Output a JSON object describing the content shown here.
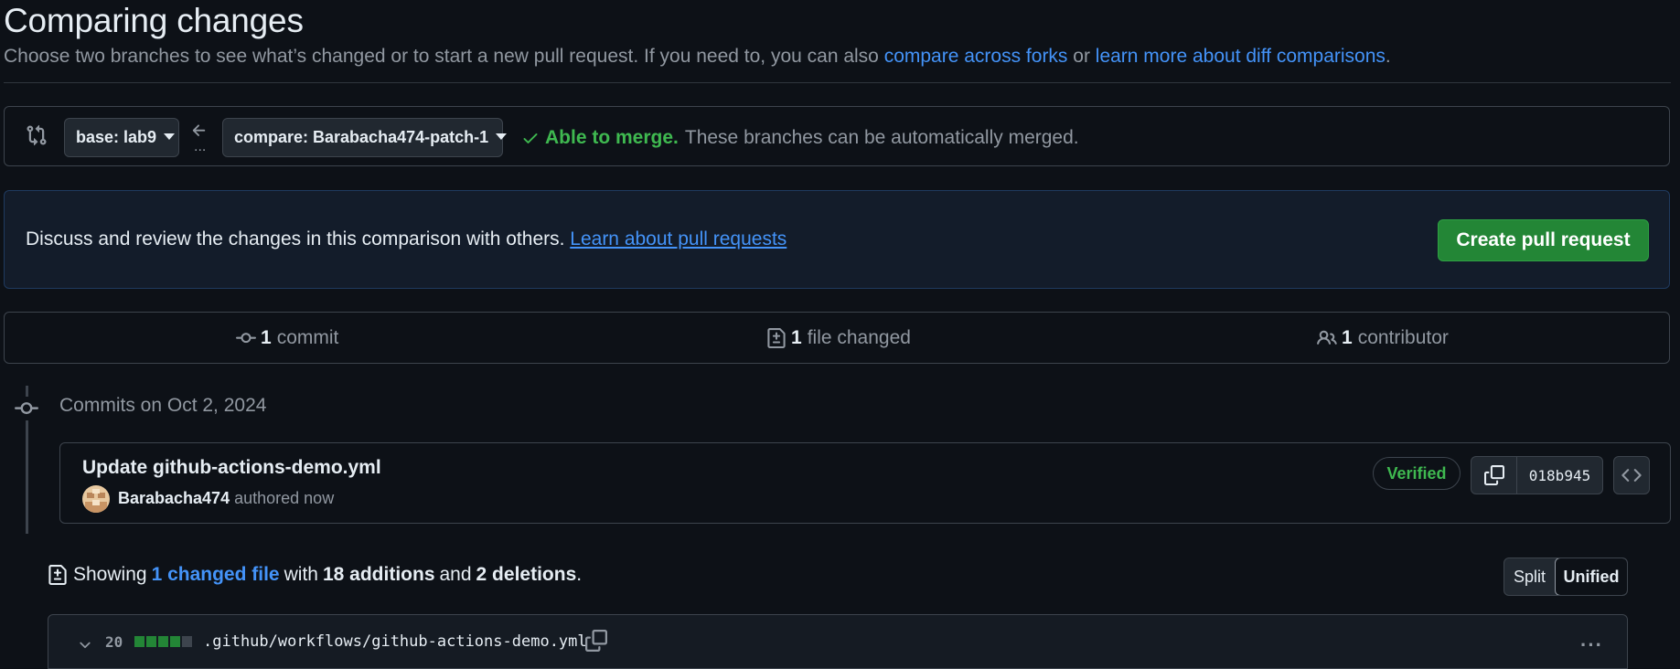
{
  "page": {
    "title": "Comparing changes",
    "subtitle_prefix": "Choose two branches to see what’s changed or to start a new pull request. If you need to, you can also ",
    "compare_forks_link": "compare across forks",
    "subtitle_or": " or ",
    "learn_diff_link": "learn more about diff comparisons",
    "subtitle_suffix": "."
  },
  "range": {
    "base_label": "base: lab9",
    "compare_label": "compare: Barabacha474-patch-1",
    "merge_ok": "Able to merge.",
    "merge_text": "These branches can be automatically merged.",
    "dots": "..."
  },
  "flash": {
    "text": "Discuss and review the changes in this comparison with others. ",
    "link": "Learn about pull requests",
    "button": "Create pull request"
  },
  "summary": {
    "commits_count": "1",
    "commits_label": "commit",
    "files_count": "1",
    "files_label": "file changed",
    "contributors_count": "1",
    "contributors_label": "contributor"
  },
  "commits": {
    "date_heading": "Commits on Oct 2, 2024",
    "items": [
      {
        "title": "Update github-actions-demo.yml",
        "author": "Barabacha474",
        "authored": "authored now",
        "verified": "Verified",
        "sha": "018b945"
      }
    ]
  },
  "showing": {
    "prefix": "Showing",
    "changed_link": "1 changed file",
    "with": "with",
    "additions": "18 additions",
    "and": "and",
    "deletions": "2 deletions",
    "suffix": ".",
    "split": "Split",
    "unified": "Unified"
  },
  "file": {
    "changes": "20",
    "path": ".github/workflows/github-actions-demo.yml",
    "diffstat": [
      "added",
      "added",
      "added",
      "added",
      "neutral"
    ],
    "colors": {
      "added": "#238636",
      "neutral": "#3d444d"
    },
    "kebab": "···"
  },
  "colors": {
    "background": "#0d1117",
    "accent_link": "#4493f8",
    "success": "#3fb950",
    "primary_button": "#238636",
    "border": "#3d444d"
  },
  "icons": {
    "compare": "git-compare-icon",
    "arrow": "arrow-left-icon",
    "check": "check-icon",
    "commit": "git-commit-icon",
    "file_diff": "file-diff-icon",
    "people": "people-icon",
    "copy": "copy-icon",
    "code": "code-icon",
    "chevron": "chevron-down-icon",
    "kebab": "kebab-horizontal-icon"
  }
}
